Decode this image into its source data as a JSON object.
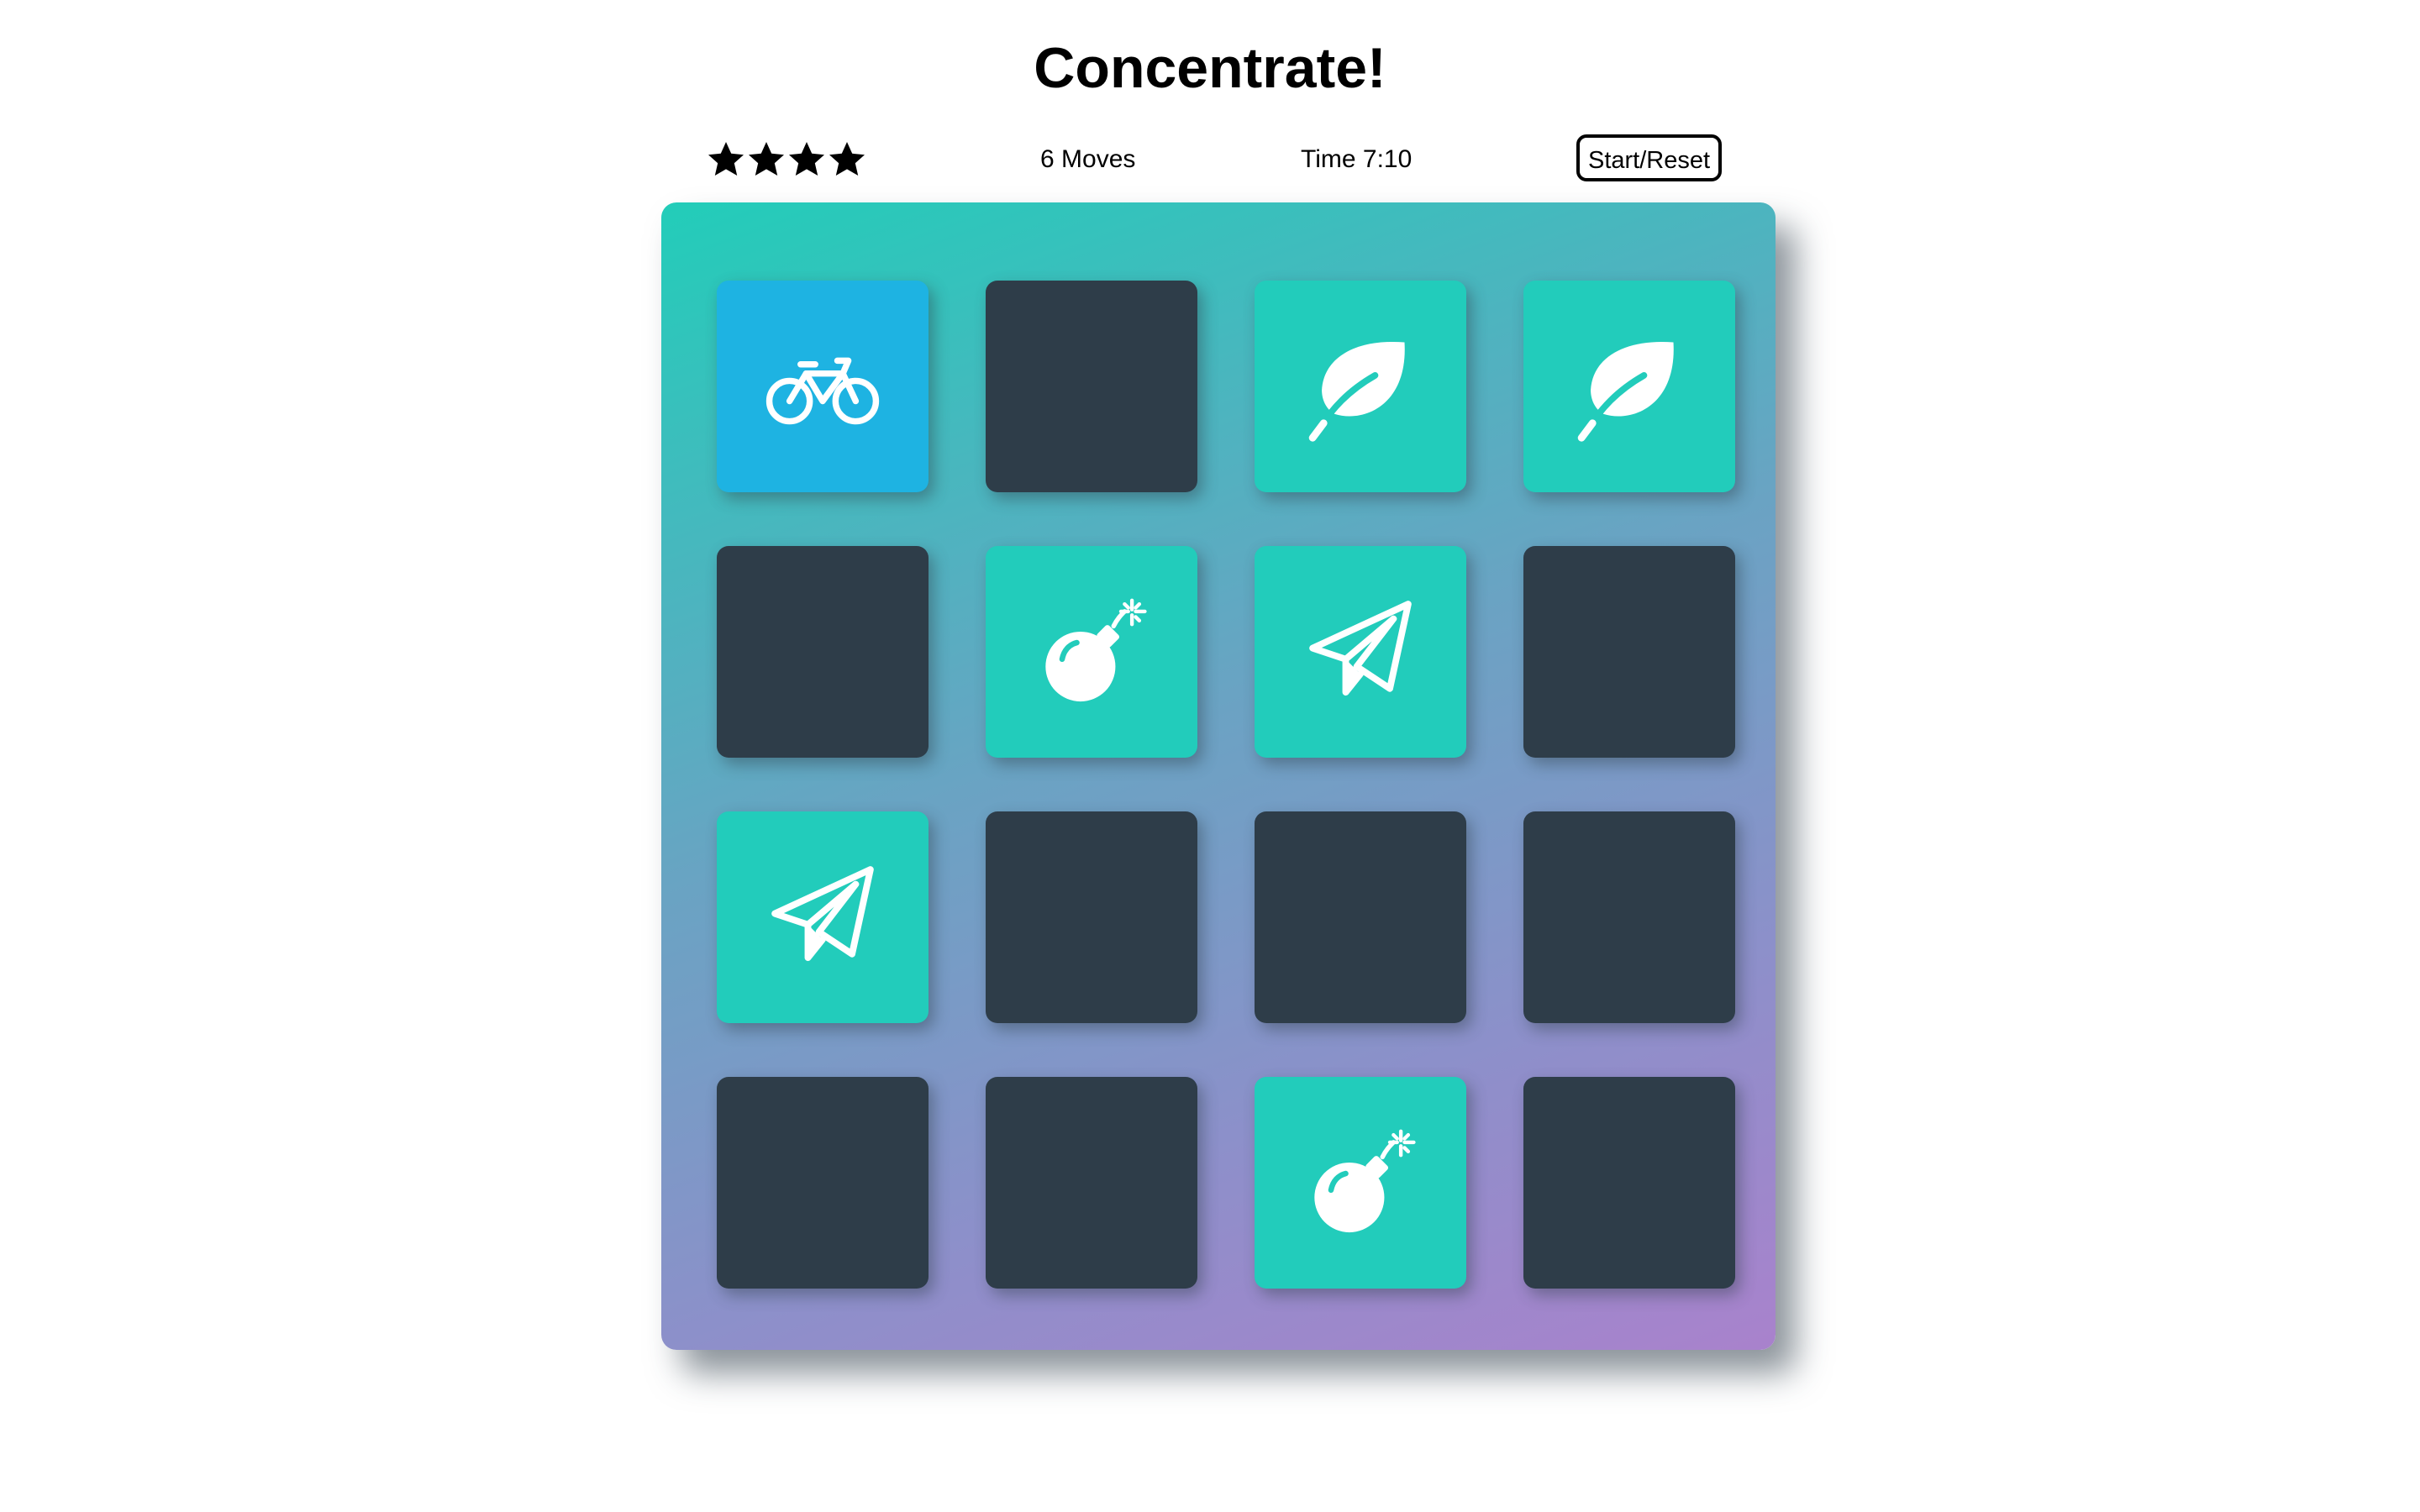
{
  "title": "Concentrate!",
  "score_panel": {
    "stars": [
      {
        "icon": "star-icon",
        "filled": true
      },
      {
        "icon": "star-icon",
        "filled": true
      },
      {
        "icon": "star-icon",
        "filled": true
      },
      {
        "icon": "star-icon",
        "filled": true
      }
    ],
    "moves_text": "6 Moves",
    "timer_text": "Time 7:10",
    "restart_label": "Start/Reset"
  },
  "colors": {
    "card_hidden": "#2e3d49",
    "card_match": "#22ccbb",
    "card_open": "#1eb3e2",
    "deck_gradient_start": "#22cdb9",
    "deck_gradient_end": "#a982cc"
  },
  "deck": {
    "rows": 4,
    "cols": 4,
    "cards": [
      {
        "state": "open",
        "icon": "bicycle-icon"
      },
      {
        "state": "hidden",
        "icon": ""
      },
      {
        "state": "match",
        "icon": "leaf-icon"
      },
      {
        "state": "match",
        "icon": "leaf-icon"
      },
      {
        "state": "hidden",
        "icon": ""
      },
      {
        "state": "match",
        "icon": "bomb-icon"
      },
      {
        "state": "match",
        "icon": "paper-plane-icon"
      },
      {
        "state": "hidden",
        "icon": ""
      },
      {
        "state": "match",
        "icon": "paper-plane-icon"
      },
      {
        "state": "hidden",
        "icon": ""
      },
      {
        "state": "hidden",
        "icon": ""
      },
      {
        "state": "hidden",
        "icon": ""
      },
      {
        "state": "hidden",
        "icon": ""
      },
      {
        "state": "hidden",
        "icon": ""
      },
      {
        "state": "match",
        "icon": "bomb-icon"
      },
      {
        "state": "hidden",
        "icon": ""
      }
    ]
  }
}
